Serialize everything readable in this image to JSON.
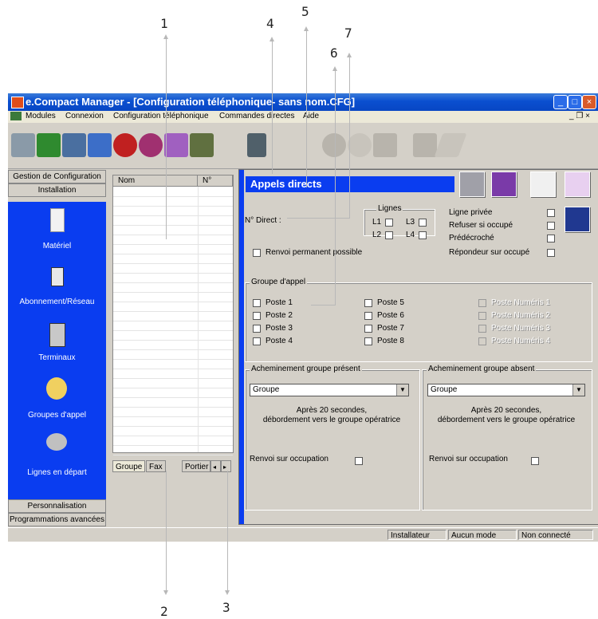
{
  "callouts": [
    "1",
    "2",
    "3",
    "4",
    "5",
    "6",
    "7"
  ],
  "window": {
    "title": "e.Compact Manager - [Configuration téléphonique- sans nom.CFG]",
    "minimize_icon": "minimize-icon",
    "maximize_icon": "maximize-icon",
    "close_icon": "close-icon"
  },
  "menu": [
    "Modules",
    "Connexion",
    "Configuration téléphonique",
    "Commandes directes",
    "Aide"
  ],
  "menu_right": "_ ❐ ×",
  "left_panel": {
    "header_top": "Gestion de Configuration",
    "header_install": "Installation",
    "items": [
      "Matériel",
      "Abonnement/Réseau",
      "Terminaux",
      "Groupes d'appel",
      "Lignes en départ"
    ],
    "footer_items": [
      "Personnalisation",
      "Programmations avancées"
    ]
  },
  "list": {
    "columns": [
      "Nom",
      "N°"
    ],
    "tabs": [
      "Groupe",
      "Fax",
      "Portier"
    ],
    "scroll_left": "◂",
    "scroll_right": "▸"
  },
  "main": {
    "section_title": "Appels directs",
    "n_direct_label": "N° Direct :",
    "lignes_title": "Lignes",
    "lines": [
      "L1",
      "L3",
      "L2",
      "L4"
    ],
    "renvoi_permanent": "Renvoi permanent possible",
    "right_options": [
      "Ligne privée",
      "Refuser si occupé",
      "Prédécroché",
      "Répondeur sur occupé"
    ],
    "groupe_appel_title": "Groupe d'appel",
    "postes": [
      "Poste 1",
      "Poste 2",
      "Poste 3",
      "Poste 4",
      "Poste 5",
      "Poste 6",
      "Poste 7",
      "Poste 8"
    ],
    "postes_numeris": [
      "Poste Numéris 1",
      "Poste Numéris 2",
      "Poste Numéris 3",
      "Poste Numéris 4"
    ],
    "present": {
      "title": "Acheminement groupe présent",
      "combo": "Groupe",
      "text_line1": "Après 20 secondes,",
      "text_line2": "débordement vers le groupe opératrice",
      "renvoi": "Renvoi sur occupation"
    },
    "absent": {
      "title": "Acheminement groupe absent",
      "combo": "Groupe",
      "text_line1": "Après 20 secondes,",
      "text_line2": "débordement vers le groupe opératrice",
      "renvoi": "Renvoi sur occupation"
    }
  },
  "status": [
    "Installateur",
    "Aucun mode",
    "Non connecté"
  ],
  "combo_arrow": "▼"
}
